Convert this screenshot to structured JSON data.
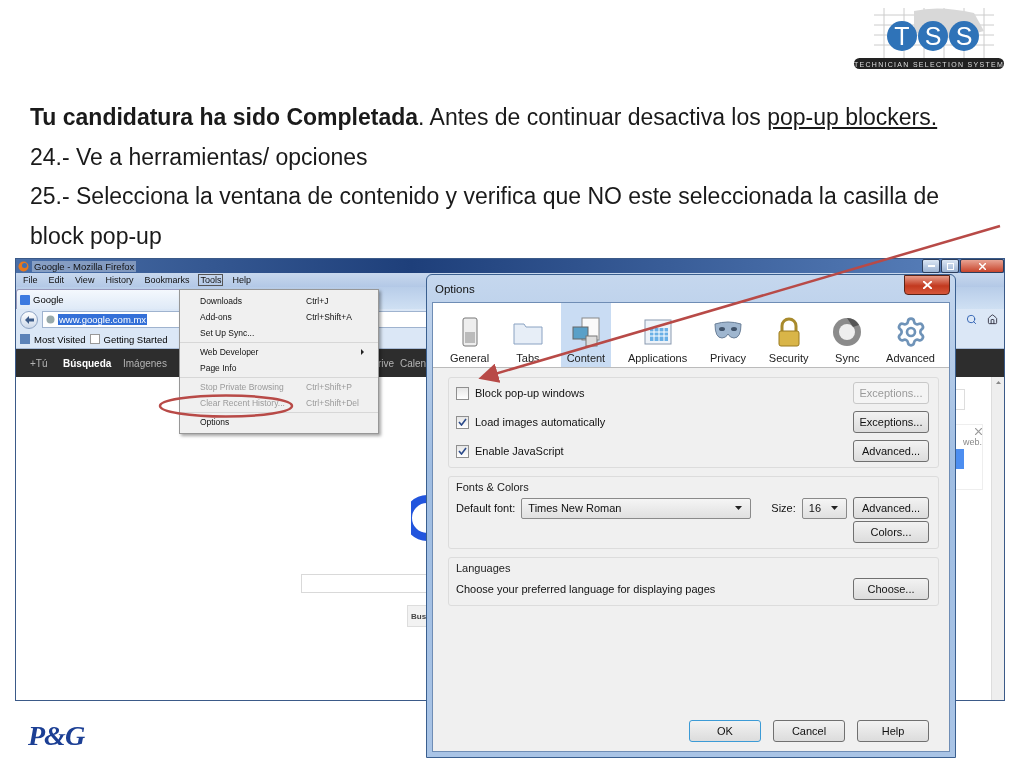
{
  "logo": {
    "letters": [
      "T",
      "S",
      "S"
    ],
    "tagline": "TECHNICIAN SELECTION SYSTEM"
  },
  "instructions": {
    "lead": "**Tu candidatura ha sido Completada**. Antes de continuar desactiva los",
    "link": "pop-up blockers.",
    "steps": [
      "24.- Ve a herramientas/ opciones",
      "25.- Selecciona la ventana de contenido y verifica que NO este seleccionada la casilla de block pop-up"
    ]
  },
  "browser": {
    "title": "Google - Mozilla Firefox",
    "menu": [
      {
        "label": "File",
        "selected": false
      },
      {
        "label": "Edit",
        "selected": false
      },
      {
        "label": "View",
        "selected": false
      },
      {
        "label": "History",
        "selected": false
      },
      {
        "label": "Bookmarks",
        "selected": false
      },
      {
        "label": "Tools",
        "selected": true
      },
      {
        "label": "Help",
        "selected": false
      }
    ],
    "tab": "Google",
    "url": "www.google.com.mx",
    "bookmarks": [
      "Most Visited",
      "Getting Started"
    ],
    "google_bar": [
      {
        "label": "+Tú",
        "selected": false
      },
      {
        "label": "Búsqueda",
        "selected": true
      },
      {
        "label": "Imágenes",
        "selected": false
      },
      {
        "label": "rive",
        "selected": false
      },
      {
        "label": "Calen",
        "selected": false
      }
    ],
    "tools_menu": [
      [
        {
          "label": "Downloads",
          "shortcut": "Ctrl+J",
          "disabled": false,
          "submenu": false
        },
        {
          "label": "Add-ons",
          "shortcut": "Ctrl+Shift+A",
          "disabled": false,
          "submenu": false
        },
        {
          "label": "Set Up Sync...",
          "disabled": false,
          "submenu": false
        }
      ],
      [
        {
          "label": "Web Developer",
          "disabled": false,
          "submenu": true
        },
        {
          "label": "Page Info",
          "disabled": false,
          "submenu": false
        }
      ],
      [
        {
          "label": "Stop Private Browsing",
          "shortcut": "Ctrl+Shift+P",
          "disabled": true,
          "submenu": false
        },
        {
          "label": "Clear Recent History...",
          "shortcut": "Ctrl+Shift+Del",
          "disabled": true,
          "submenu": false
        }
      ],
      [
        {
          "label": "Options",
          "disabled": false,
          "submenu": false
        }
      ]
    ],
    "search_button": "Bus",
    "notice": "web."
  },
  "options": {
    "title": "Options",
    "panes": [
      {
        "label": "General",
        "kind": "switch",
        "selected": false
      },
      {
        "label": "Tabs",
        "kind": "folder",
        "selected": false
      },
      {
        "label": "Content",
        "kind": "pictures",
        "selected": true
      },
      {
        "label": "Applications",
        "kind": "calendar",
        "selected": false
      },
      {
        "label": "Privacy",
        "kind": "mask",
        "selected": false
      },
      {
        "label": "Security",
        "kind": "lock",
        "selected": false
      },
      {
        "label": "Sync",
        "kind": "sync",
        "selected": false
      },
      {
        "label": "Advanced",
        "kind": "gear",
        "selected": false
      }
    ],
    "checks": [
      {
        "label": "Block pop-up windows",
        "checked": false,
        "button": "Exceptions...",
        "disabled": true
      },
      {
        "label": "Load images automatically",
        "checked": true,
        "button": "Exceptions...",
        "disabled": false
      },
      {
        "label": "Enable JavaScript",
        "checked": true,
        "button": "Advanced...",
        "disabled": false
      }
    ],
    "fonts": {
      "title": "Fonts & Colors",
      "font_label": "Default font:",
      "font": "Times New Roman",
      "size_label": "Size:",
      "size": "16",
      "buttons": [
        "Advanced...",
        "Colors..."
      ]
    },
    "languages": {
      "title": "Languages",
      "text": "Choose your preferred language for displaying pages",
      "button": "Choose..."
    },
    "buttons": [
      {
        "label": "OK",
        "default": true
      },
      {
        "label": "Cancel",
        "default": false
      },
      {
        "label": "Help",
        "default": false
      }
    ]
  },
  "footer_logo": "P&G"
}
